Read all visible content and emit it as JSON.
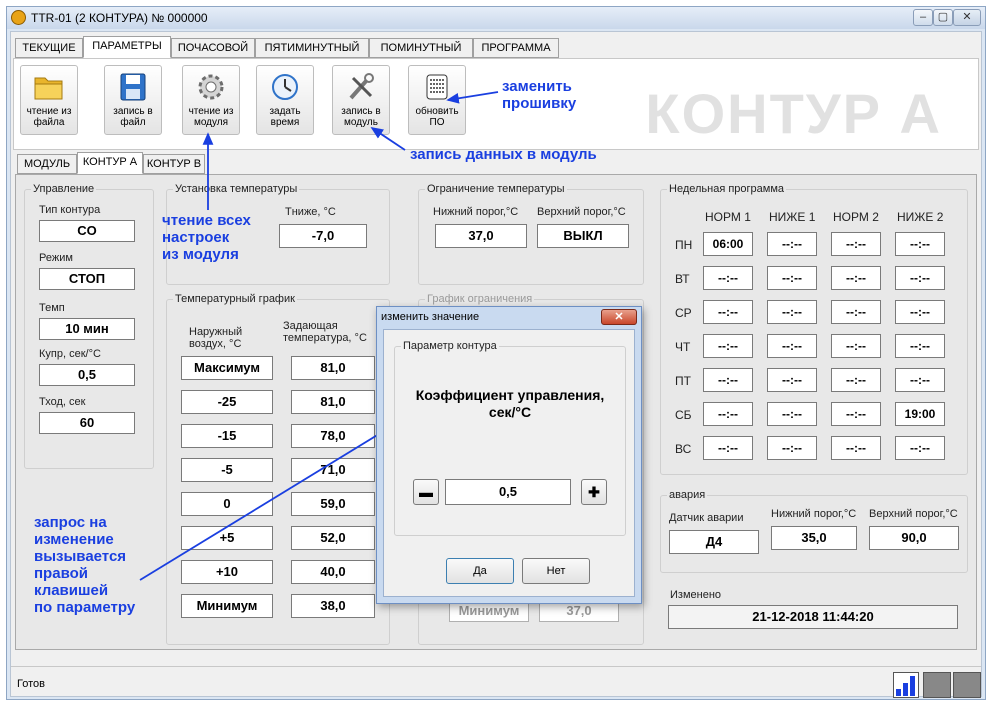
{
  "window": {
    "title": "TTR-01 (2 КОНТУРА) № 000000",
    "controls": [
      "–",
      "▢",
      "✕"
    ]
  },
  "menu_tabs": [
    "ТЕКУЩИЕ",
    "ПАРАМЕТРЫ",
    "ПОЧАСОВОЙ",
    "ПЯТИМИНУТНЫЙ",
    "ПОМИНУТНЫЙ",
    "ПРОГРАММА"
  ],
  "toolbar": {
    "read_file": "чтение из\nфайла",
    "write_file": "запись в\nфайл",
    "read_module": "чтение из\nмодуля",
    "set_time": "задать\nвремя",
    "write_module": "запись в\nмодуль",
    "update_fw": "обновить\nПО"
  },
  "contour_title": "КОНТУР А",
  "annotations": {
    "firmware": "заменить\nпрошивку",
    "write_data": "запись данных в модуль",
    "read_all": "чтение всех\nнастроек\nиз модуля",
    "right_click": "запрос на\nизменение\nвызывается\nправой\nклавишей\nпо параметру"
  },
  "contour_tabs": [
    "МОДУЛЬ",
    "КОНТУР А",
    "КОНТУР В"
  ],
  "control": {
    "label": "Управление",
    "type_label": "Тип контура",
    "type_value": "CO",
    "mode_label": "Режим",
    "mode_value": "СТОП",
    "tempo_label": "Темп",
    "tempo_value": "10 мин",
    "kupr_label": "Купр, сек/°С",
    "kupr_value": "0,5",
    "tin_label": "Тход, сек",
    "tin_value": "60"
  },
  "temp_setting": {
    "label": "Установка температуры",
    "lower_label": "Тниже, °С",
    "lower_value": "-7,0"
  },
  "temp_limit": {
    "label": "Ограничение температуры",
    "low_label": "Нижний порог,°С",
    "low_value": "37,0",
    "high_label": "Верхний порог,°С",
    "high_value": "ВЫКЛ"
  },
  "temp_graph": {
    "label": "Температурный график",
    "col1": "Наружный\nвоздух, °С",
    "col2": "Задающая\nтемпература, °С",
    "rows": [
      {
        "outside": "Максимум",
        "target": "81,0"
      },
      {
        "outside": "-25",
        "target": "81,0"
      },
      {
        "outside": "-15",
        "target": "78,0"
      },
      {
        "outside": "-5",
        "target": "71,0"
      },
      {
        "outside": "0",
        "target": "59,0"
      },
      {
        "outside": "+5",
        "target": "52,0"
      },
      {
        "outside": "+10",
        "target": "40,0"
      },
      {
        "outside": "Минимум",
        "target": "38,0"
      }
    ]
  },
  "limit_graph": {
    "label": "График ограничения",
    "last_outside": "Минимум",
    "last_target": "37,0"
  },
  "weekly": {
    "label": "Недельная программа",
    "headers": [
      "НОРМ 1",
      "НИЖЕ 1",
      "НОРМ 2",
      "НИЖЕ 2"
    ],
    "days": [
      {
        "day": "ПН",
        "values": [
          "06:00",
          "--:--",
          "--:--",
          "--:--"
        ]
      },
      {
        "day": "ВТ",
        "values": [
          "--:--",
          "--:--",
          "--:--",
          "--:--"
        ]
      },
      {
        "day": "СР",
        "values": [
          "--:--",
          "--:--",
          "--:--",
          "--:--"
        ]
      },
      {
        "day": "ЧТ",
        "values": [
          "--:--",
          "--:--",
          "--:--",
          "--:--"
        ]
      },
      {
        "day": "ПТ",
        "values": [
          "--:--",
          "--:--",
          "--:--",
          "--:--"
        ]
      },
      {
        "day": "СБ",
        "values": [
          "--:--",
          "--:--",
          "--:--",
          "19:00"
        ]
      },
      {
        "day": "ВС",
        "values": [
          "--:--",
          "--:--",
          "--:--",
          "--:--"
        ]
      }
    ]
  },
  "alarm": {
    "label": "авария",
    "sensor_label": "Датчик аварии",
    "sensor_value": "Д4",
    "low_label": "Нижний порог,°С",
    "low_value": "35,0",
    "high_label": "Верхний порог,°С",
    "high_value": "90,0"
  },
  "changed": {
    "label": "Изменено",
    "value": "21-12-2018 11:44:20"
  },
  "status_text": "Готов",
  "dialog": {
    "title": "изменить значение",
    "group_label": "Параметр контура",
    "param_name": "Коэффициент управления,\nсек/°С",
    "value": "0,5",
    "yes": "Да",
    "no": "Нет"
  },
  "colors": {
    "annotation": "#1a3fe0",
    "big_title": "#e1e1e1"
  }
}
